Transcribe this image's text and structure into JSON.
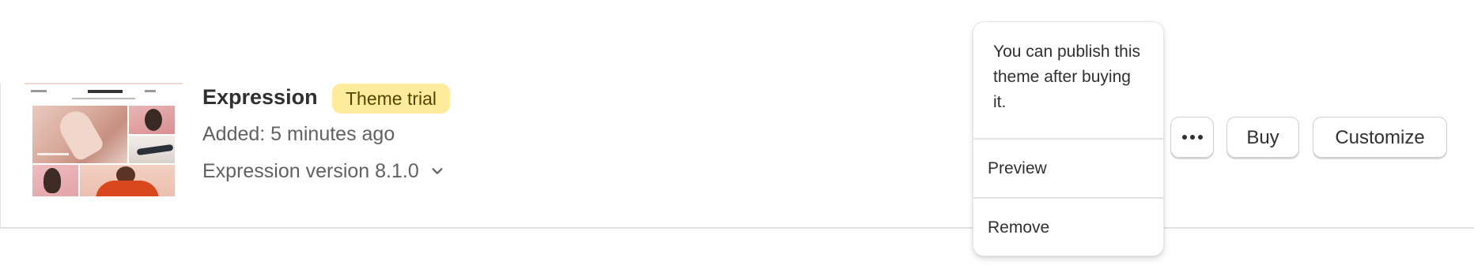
{
  "theme": {
    "name": "Expression",
    "badge": "Theme trial",
    "added": "Added: 5 minutes ago",
    "version": "Expression version 8.1.0",
    "thumbnail_brand": "EXPRESSION"
  },
  "actions": {
    "more_icon": "ellipsis-icon",
    "buy_label": "Buy",
    "customize_label": "Customize"
  },
  "popover": {
    "note": "You can publish this theme after buying it.",
    "items": [
      {
        "label": "Preview"
      },
      {
        "label": "Remove"
      }
    ]
  },
  "colors": {
    "badge_bg": "#ffeb9c",
    "badge_text": "#4f4700",
    "text_primary": "#303030",
    "text_secondary": "#616161"
  }
}
